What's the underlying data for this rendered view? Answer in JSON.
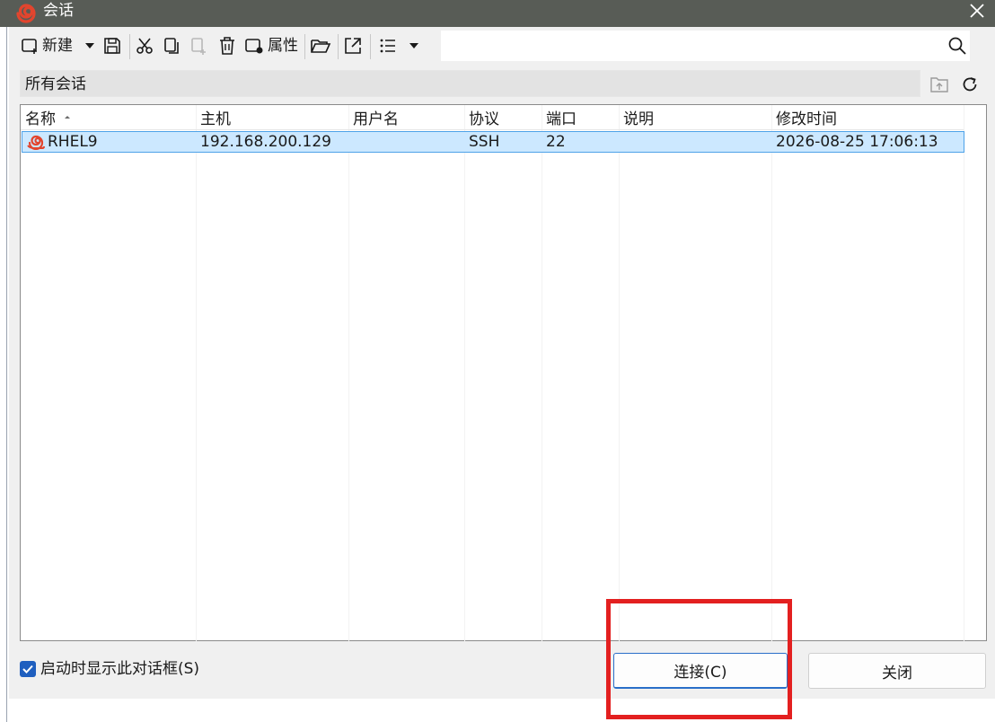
{
  "window": {
    "title": "会话"
  },
  "toolbar": {
    "new_label": "新建",
    "properties_label": "属性"
  },
  "search": {
    "placeholder": "",
    "value": ""
  },
  "path": {
    "label": "所有会话"
  },
  "table": {
    "columns": [
      "名称",
      "主机",
      "用户名",
      "协议",
      "端口",
      "说明",
      "修改时间"
    ],
    "rows": [
      {
        "name": "RHEL9",
        "host": "192.168.200.129",
        "user": "",
        "protocol": "SSH",
        "port": "22",
        "desc": "",
        "modified": "2026-08-25 17:06:13"
      }
    ]
  },
  "footer": {
    "startup_checkbox_label": "启动时显示此对话框(S)",
    "startup_checked": true,
    "connect_label": "连接(C)",
    "close_label": "关闭"
  },
  "colors": {
    "titlebar": "#585c56",
    "accent": "#1f5fbf",
    "selection": "#cce8ff",
    "highlight_box": "#e32020",
    "brand": "#e2452e"
  }
}
